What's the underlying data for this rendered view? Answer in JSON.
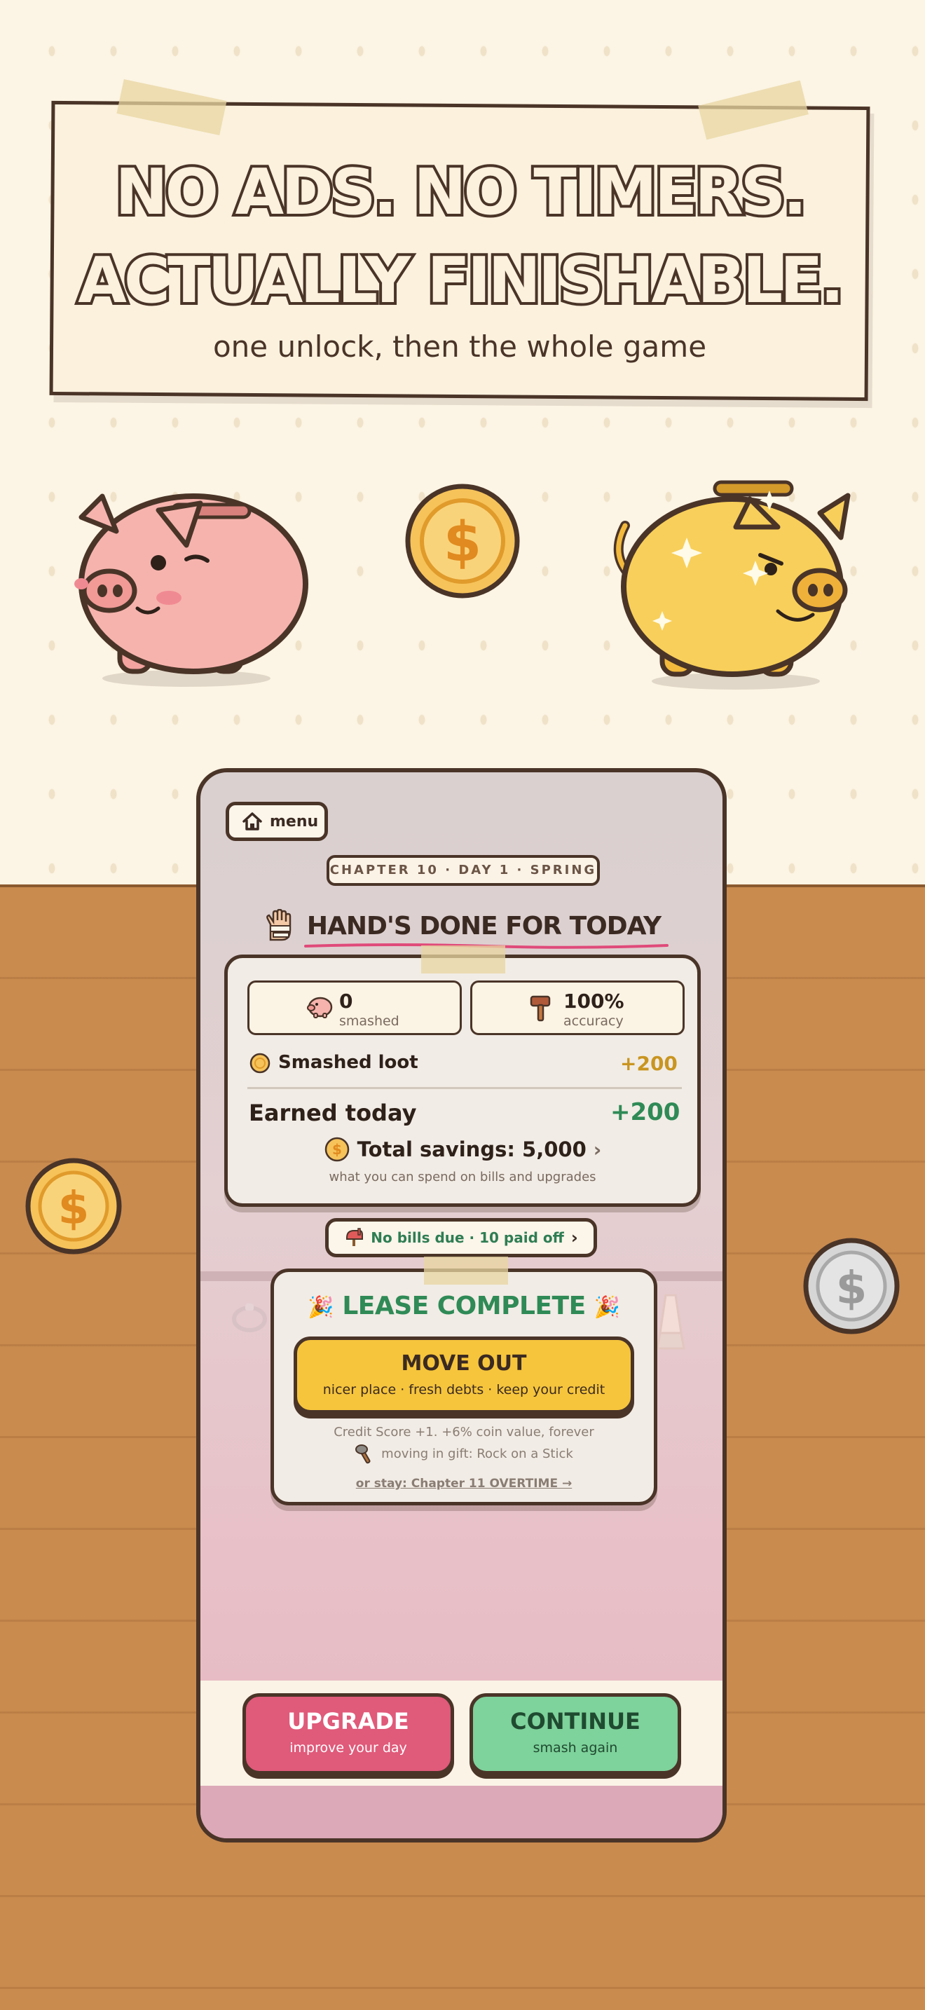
{
  "banner": {
    "headline_line1": "NO ADS. NO TIMERS.",
    "headline_line2": "ACTUALLY FINISHABLE.",
    "subline": "one unlock, then the whole game"
  },
  "icons": {
    "coin": "dollar-coin-icon",
    "silver_coin": "silver-coin-icon",
    "pink_pig": "pink-piggy-bank-icon",
    "gold_pig": "gold-piggy-bank-icon"
  },
  "game": {
    "menu_label": "menu",
    "chapter_tag": "CHAPTER 10 · DAY 1 · SPRING",
    "title": "HAND'S DONE FOR TODAY",
    "stats": {
      "smashed_value": "0",
      "smashed_label": "smashed",
      "accuracy_value": "100%",
      "accuracy_label": "accuracy",
      "loot_label": "Smashed loot",
      "loot_value": "+200",
      "earned_label": "Earned today",
      "earned_value": "+200",
      "savings_label": "Total savings: 5,000",
      "savings_note": "what you can spend on bills and upgrades"
    },
    "bills_pill": "No bills due · 10 paid off",
    "lease": {
      "title": "LEASE COMPLETE",
      "move_out_title": "MOVE OUT",
      "move_out_sub": "nicer place · fresh debts · keep your credit",
      "note_1": "Credit Score +1. +6% coin value, forever",
      "note_2": "moving in gift: Rock on a Stick",
      "stay_link": "or stay: Chapter 11 OVERTIME →"
    },
    "upgrade_title": "UPGRADE",
    "upgrade_sub": "improve your day",
    "continue_title": "CONTINUE",
    "continue_sub": "smash again"
  },
  "colors": {
    "outline": "#4a3428",
    "accent_green": "#2f8a56",
    "accent_gold": "#c99520",
    "upgrade_pink": "#e05a7a",
    "continue_green": "#7ed29b",
    "move_yellow": "#f6c53c"
  }
}
